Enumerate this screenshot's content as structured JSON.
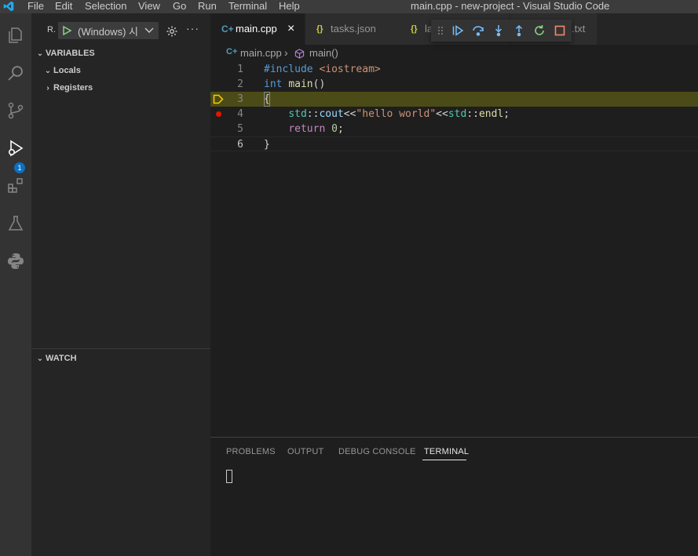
{
  "window": {
    "title": "main.cpp - new-project - Visual Studio Code",
    "menu": [
      "File",
      "Edit",
      "Selection",
      "View",
      "Go",
      "Run",
      "Terminal",
      "Help"
    ]
  },
  "activity": {
    "icons": [
      "explorer-icon",
      "search-icon",
      "source-control-icon",
      "run-debug-icon",
      "extensions-icon",
      "testing-icon",
      "python-icon"
    ],
    "debug_badge": "1"
  },
  "sidebar": {
    "run_label": "R.",
    "config_select": "(Windows) 시",
    "variables_header": "VARIABLES",
    "variables_items": [
      "Locals",
      "Registers"
    ],
    "watch_header": "WATCH"
  },
  "tabs": [
    {
      "label": "main.cpp",
      "active": true,
      "close": "×"
    },
    {
      "label": "tasks.json",
      "active": false
    },
    {
      "label": "la",
      "active": false
    },
    {
      "label": ".txt",
      "active": false
    }
  ],
  "breadcrumb": {
    "file": "main.cpp",
    "sep": "›",
    "symbol": "main()"
  },
  "editor": {
    "line_numbers": [
      "1",
      "2",
      "3",
      "4",
      "5",
      "6"
    ],
    "lines": [
      [
        {
          "t": "#include ",
          "c": "kw"
        },
        {
          "t": "<iostream>",
          "c": "str"
        }
      ],
      [
        {
          "t": "int",
          "c": "kw"
        },
        {
          "t": " ",
          "c": "plain"
        },
        {
          "t": "main",
          "c": "fn"
        },
        {
          "t": "()",
          "c": "plain"
        }
      ],
      [
        {
          "t": "{",
          "c": "plain"
        }
      ],
      [
        {
          "t": "    ",
          "c": "plain"
        },
        {
          "t": "std",
          "c": "ns"
        },
        {
          "t": "::",
          "c": "plain"
        },
        {
          "t": "cout",
          "c": "var"
        },
        {
          "t": "<<",
          "c": "plain"
        },
        {
          "t": "\"hello world\"",
          "c": "str"
        },
        {
          "t": "<<",
          "c": "plain"
        },
        {
          "t": "std",
          "c": "ns"
        },
        {
          "t": "::",
          "c": "plain"
        },
        {
          "t": "endl",
          "c": "fn"
        },
        {
          "t": ";",
          "c": "plain"
        }
      ],
      [
        {
          "t": "    ",
          "c": "plain"
        },
        {
          "t": "return",
          "c": "ctrl"
        },
        {
          "t": " ",
          "c": "plain"
        },
        {
          "t": "0",
          "c": "num"
        },
        {
          "t": ";",
          "c": "plain"
        }
      ],
      [
        {
          "t": "}",
          "c": "plain"
        }
      ]
    ],
    "current_line": 3,
    "breakpoint_line": 4,
    "colors": {
      "kw": "#569cd6",
      "str": "#ce9178",
      "fn": "#dcdcaa",
      "plain": "#d4d4d4",
      "ns": "#4ec9b0",
      "var": "#9cdcfe",
      "ctrl": "#c586c0",
      "num": "#b5cea8",
      "debug_line_bg": "#4b4b18",
      "breakpoint": "#e51400",
      "current_arrow": "#ffcc00"
    }
  },
  "debug_toolbar": [
    "grip-icon",
    "continue-icon",
    "step-over-icon",
    "step-into-icon",
    "step-out-icon",
    "restart-icon",
    "stop-icon"
  ],
  "panel": {
    "tabs": [
      "PROBLEMS",
      "OUTPUT",
      "DEBUG CONSOLE",
      "TERMINAL"
    ],
    "active_tab": "TERMINAL"
  }
}
